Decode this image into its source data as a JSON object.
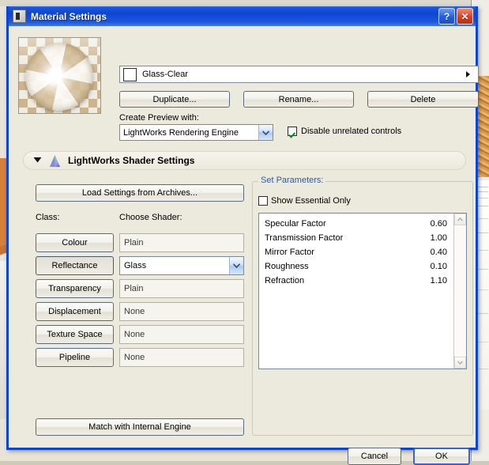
{
  "window": {
    "title": "Material Settings",
    "icon": "app-icon",
    "help_button": "?",
    "close_button": "✕",
    "titlebar_color": "#0d46d4",
    "face_color": "#ece9dd"
  },
  "material": {
    "name": "Glass-Clear",
    "swatch_color": "#ffffff",
    "duplicate_label": "Duplicate...",
    "rename_label": "Rename...",
    "delete_label": "Delete",
    "create_preview_label": "Create Preview with:",
    "engine": "LightWorks Rendering Engine",
    "disable_unrelated": {
      "label": "Disable unrelated controls",
      "checked": true
    }
  },
  "section": {
    "title": "LightWorks Shader Settings",
    "expanded": true,
    "load_settings_label": "Load Settings from Archives...",
    "match_engine_label": "Match with Internal Engine"
  },
  "shader_table": {
    "class_header": "Class:",
    "shader_header": "Choose Shader:",
    "rows": [
      {
        "class": "Colour",
        "shader": "Plain",
        "selected": false,
        "dropdown": false
      },
      {
        "class": "Reflectance",
        "shader": "Glass",
        "selected": true,
        "dropdown": true
      },
      {
        "class": "Transparency",
        "shader": "Plain",
        "selected": false,
        "dropdown": false
      },
      {
        "class": "Displacement",
        "shader": "None",
        "selected": false,
        "dropdown": false
      },
      {
        "class": "Texture Space",
        "shader": "None",
        "selected": false,
        "dropdown": false
      },
      {
        "class": "Pipeline",
        "shader": "None",
        "selected": false,
        "dropdown": false
      }
    ]
  },
  "parameters": {
    "legend": "Set Parameters:",
    "legend_color": "#2b5ca8",
    "show_essential_only": {
      "label": "Show Essential Only",
      "checked": false
    },
    "items": [
      {
        "name": "Specular Factor",
        "value": "0.60"
      },
      {
        "name": "Transmission Factor",
        "value": "1.00"
      },
      {
        "name": "Mirror Factor",
        "value": "0.40"
      },
      {
        "name": "Roughness",
        "value": "0.10"
      },
      {
        "name": "Refraction",
        "value": "1.10"
      }
    ]
  },
  "footer": {
    "cancel_label": "Cancel",
    "ok_label": "OK"
  }
}
